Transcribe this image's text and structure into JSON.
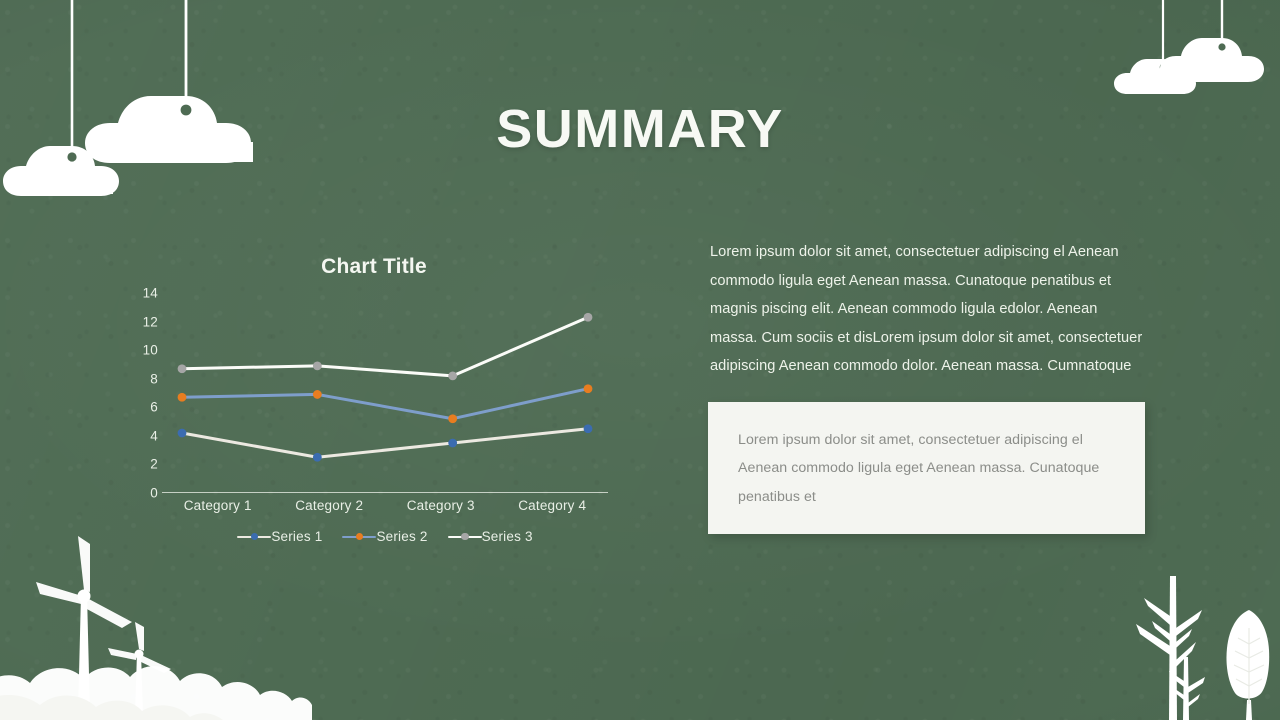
{
  "slide": {
    "title": "SUMMARY",
    "background_color": "#4e6b53"
  },
  "body": {
    "paragraph": "Lorem ipsum dolor sit amet, consectetuer adipiscing el Aenean commodo  ligula eget Aenean massa. Cunatoque penatibus et magnis piscing elit. Aenean commodo  ligula edolor.  Aenean massa. Cum sociis et disLorem ipsum dolor sit amet,  consectetuer adipiscing Aenean commodo  dolor.  Aenean massa. Cumnatoque"
  },
  "callout": {
    "text": "Lorem ipsum dolor sit amet, consectetuer adipiscing el Aenean commodo  ligula eget Aenean massa. Cunatoque penatibus et",
    "background_color": "#f4f5f1",
    "text_color": "#8b8d89"
  },
  "chart_data": {
    "type": "line",
    "title": "Chart Title",
    "xlabel": "",
    "ylabel": "",
    "categories": [
      "Category 1",
      "Category 2",
      "Category 3",
      "Category 4"
    ],
    "ylim": [
      0,
      14
    ],
    "yticks": [
      14,
      12,
      10,
      8,
      6,
      4,
      2,
      0
    ],
    "grid": false,
    "legend_position": "bottom",
    "series": [
      {
        "name": "Series 1",
        "values": [
          4.2,
          2.5,
          3.5,
          4.5
        ],
        "line_color": "#ece9e1",
        "marker_color": "#3b6cb0"
      },
      {
        "name": "Series 2",
        "values": [
          6.7,
          6.9,
          5.2,
          7.3
        ],
        "line_color": "#7e9ecb",
        "marker_color": "#e87d20"
      },
      {
        "name": "Series 3",
        "values": [
          8.7,
          8.9,
          8.2,
          12.3
        ],
        "line_color": "#fbfcf8",
        "marker_color": "#a6a6a6"
      }
    ],
    "axis_line_color": "#eef2ea",
    "tick_label_color": "#e9efe6"
  },
  "decorations": {
    "clouds": [
      "hanging-cloud-small-left",
      "hanging-cloud-large-left",
      "hanging-cloud-small-right",
      "hanging-cloud-large-right"
    ],
    "turbines": [
      "wind-turbine-large",
      "wind-turbine-small"
    ],
    "trees": [
      "bare-tree-large",
      "bare-tree-small",
      "conifer-tree"
    ],
    "hills": [
      "cloud-hill-bottom-left"
    ],
    "color": "#ffffff"
  }
}
